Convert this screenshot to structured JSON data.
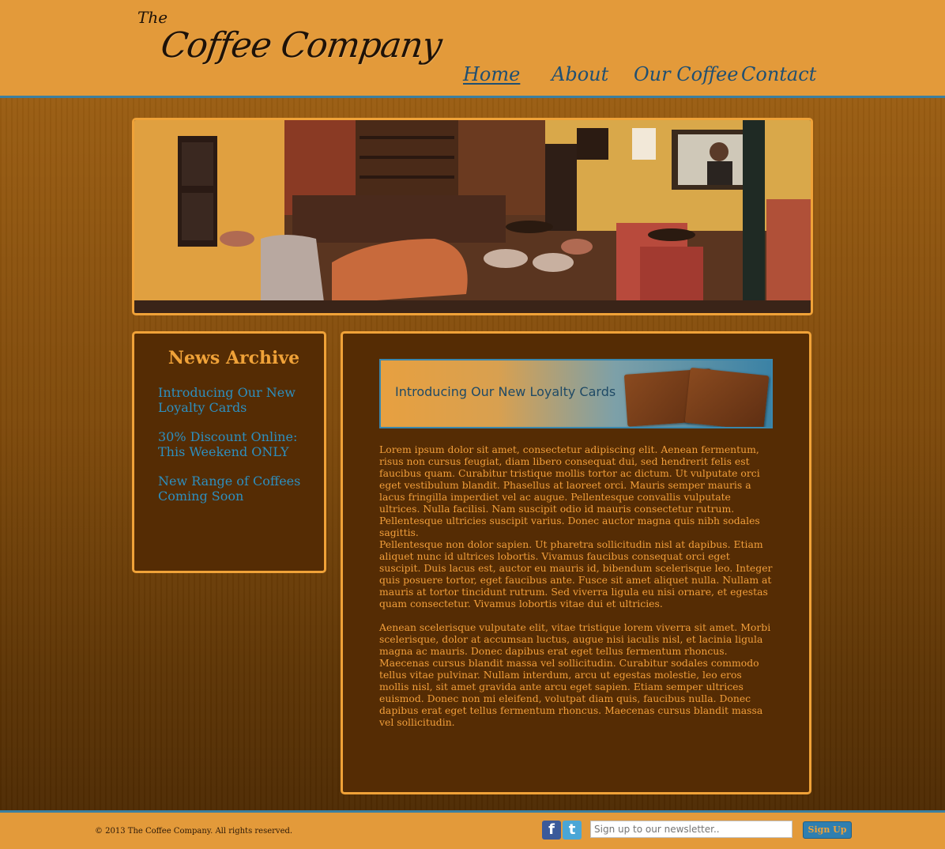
{
  "site": {
    "logo_small": "The",
    "logo_main": "Coffee Company"
  },
  "nav": {
    "items": [
      {
        "label": "Home",
        "active": true
      },
      {
        "label": "About",
        "active": false
      },
      {
        "label": "Our Coffee",
        "active": false
      },
      {
        "label": "Contact",
        "active": false
      }
    ]
  },
  "hero": {
    "image_description": "cafe-interior-photo"
  },
  "sidebar": {
    "title": "News Archive",
    "links": [
      {
        "label": "Introducing Our New Loyalty Cards"
      },
      {
        "label": "30% Discount Online: This Weekend ONLY"
      },
      {
        "label": "New Range of Coffees Coming Soon"
      }
    ]
  },
  "main": {
    "banner_text": "Introducing Our New Loyalty Cards",
    "paragraphs": [
      "Lorem ipsum dolor sit amet, consectetur adipiscing elit. Aenean fermentum, risus non cursus feugiat, diam libero consequat dui, sed hendrerit felis est faucibus quam. Curabitur tristique mollis tortor ac dictum. Ut vulputate orci eget vestibulum blandit. Phasellus at laoreet orci. Mauris semper mauris a lacus fringilla imperdiet vel ac augue. Pellentesque convallis vulputate ultrices. Nulla facilisi. Nam suscipit odio id mauris consectetur rutrum. Pellentesque ultricies suscipit varius. Donec auctor magna quis nibh sodales sagittis.",
      "Pellentesque non dolor sapien. Ut pharetra sollicitudin nisl at dapibus. Etiam aliquet nunc id ultrices lobortis. Vivamus faucibus consequat orci eget suscipit. Duis lacus est, auctor eu mauris id, bibendum scelerisque leo. Integer quis posuere tortor, eget faucibus ante. Fusce sit amet aliquet nulla. Nullam at mauris at tortor tincidunt rutrum. Sed viverra ligula eu nisi ornare, et egestas quam consectetur. Vivamus lobortis vitae dui et ultricies.",
      "Aenean scelerisque vulputate elit, vitae tristique lorem viverra sit amet. Morbi scelerisque, dolor at accumsan luctus, augue nisi iaculis nisl, et lacinia ligula magna ac mauris. Donec dapibus erat eget tellus fermentum rhoncus. Maecenas cursus blandit massa vel sollicitudin. Curabitur sodales commodo tellus vitae pulvinar. Nullam interdum, arcu ut egestas molestie, leo eros mollis nisl, sit amet gravida ante arcu eget sapien. Etiam semper ultrices euismod. Donec non mi eleifend, volutpat diam quis, faucibus nulla. Donec dapibus erat eget tellus fermentum rhoncus. Maecenas cursus blandit massa vel sollicitudin."
    ]
  },
  "footer": {
    "copyright": "© 2013 The Coffee Company. All rights reserved.",
    "facebook_glyph": "f",
    "twitter_glyph": "t",
    "newsletter_placeholder": "Sign up to our newsletter..",
    "signup_label": "Sign Up"
  },
  "colors": {
    "header_bg": "#e39a3a",
    "accent_blue": "#3b7fa0",
    "panel_bg": "#552c04",
    "panel_border": "#f0a238",
    "link_blue": "#2d8fbf",
    "body_text": "#f29f3b"
  },
  "icons": [
    "facebook-icon",
    "twitter-icon"
  ]
}
